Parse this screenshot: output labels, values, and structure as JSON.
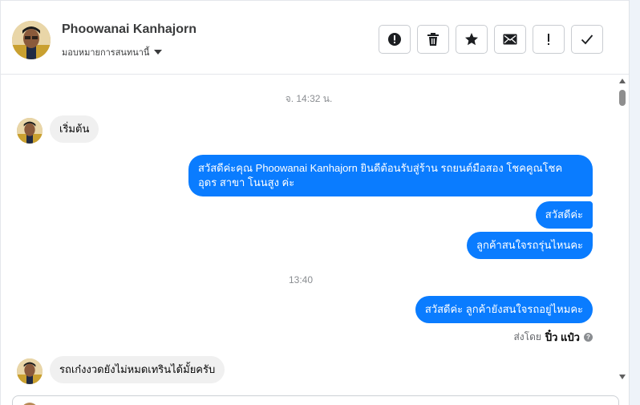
{
  "header": {
    "contact_name": "Phoowanai Kanhajorn",
    "assign_label": "มอบหมายการสนทนานี้",
    "actions": [
      {
        "name": "spam-button",
        "icon": "alert-circle-icon"
      },
      {
        "name": "delete-button",
        "icon": "trash-icon"
      },
      {
        "name": "star-button",
        "icon": "star-icon"
      },
      {
        "name": "mark-unread-button",
        "icon": "envelope-icon"
      },
      {
        "name": "follow-up-button",
        "icon": "exclamation-icon"
      },
      {
        "name": "mark-done-button",
        "icon": "check-icon"
      }
    ]
  },
  "conversation": {
    "timestamps": [
      "จ. 14:32 น.",
      "13:40"
    ],
    "messages": [
      {
        "direction": "incoming",
        "text": "เริ่มต้น"
      },
      {
        "direction": "outgoing",
        "text": "สวัสดีค่ะคุณ Phoowanai Kanhajorn ยินดีต้อนรับสู่ร้าน รถยนต์มือสอง โชคคูณโชค อุดร สาขา โนนสูง ค่ะ"
      },
      {
        "direction": "outgoing",
        "text": "สวัสดีค่ะ"
      },
      {
        "direction": "outgoing",
        "text": "ลูกค้าสนใจรถรุ่นไหนคะ"
      },
      {
        "direction": "outgoing",
        "text": "สวัสดีค่ะ ลูกค้ายังสนใจรถอยู่ไหมคะ"
      },
      {
        "direction": "incoming",
        "text": "รถเก๋งงวดยังไม่หมดเทรินได้มั้ยครับ"
      }
    ],
    "sent_by_label": "ส่งโดย",
    "sent_by_name": "ปิ๋ว แป๋ว"
  },
  "colors": {
    "outgoing_bubble": "#0a7cff",
    "incoming_bubble": "#f0f0f0"
  }
}
